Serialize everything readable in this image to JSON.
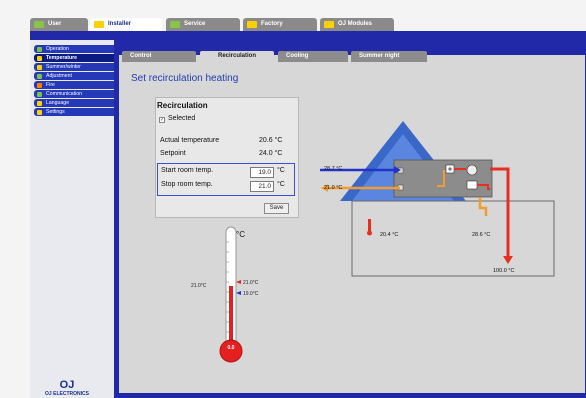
{
  "top_tabs": [
    {
      "label": "User",
      "color": "#8bc34a"
    },
    {
      "label": "Installer",
      "color": "#ffd000"
    },
    {
      "label": "Service",
      "color": "#8bc34a"
    },
    {
      "label": "Factory",
      "color": "#ffd000"
    },
    {
      "label": "OJ Modules",
      "color": "#ffd000"
    }
  ],
  "sidebar": {
    "items": [
      {
        "label": "Operation",
        "icon": "gear-icon",
        "color": "#7ac143"
      },
      {
        "label": "Temperature",
        "icon": "thermometer-icon",
        "color": "#ffd000"
      },
      {
        "label": "Summer/winter",
        "icon": "sun-icon",
        "color": "#ffd000"
      },
      {
        "label": "Adjustment",
        "icon": "wrench-icon",
        "color": "#7ac143"
      },
      {
        "label": "Fire",
        "icon": "fire-icon",
        "color": "#ff8000"
      },
      {
        "label": "Communication",
        "icon": "network-icon",
        "color": "#7ac143"
      },
      {
        "label": "Language",
        "icon": "flag-icon",
        "color": "#ffd000"
      },
      {
        "label": "Settings",
        "icon": "folder-icon",
        "color": "#ffd000"
      }
    ],
    "logo_mark": "OJ",
    "logo_text": "OJ ELECTRONICS"
  },
  "subtabs": [
    "Control",
    "Recirculation",
    "Cooling",
    "Summer night"
  ],
  "page_title": "Set recirculation heating",
  "panel": {
    "title": "Recirculation",
    "selected_label": "Selected",
    "checkmark": "✓",
    "actual_label": "Actual temperature",
    "actual_value": "20.6 °C",
    "setpoint_label": "Setpoint",
    "setpoint_value": "24.0 °C",
    "start_label": "Start room temp.",
    "start_value": "19.0",
    "stop_label": "Stop room temp.",
    "stop_value": "21.0",
    "unit": "°C",
    "save_label": "Save"
  },
  "thermometer": {
    "unit": "°C",
    "left_label": "21.0°C",
    "mark_high": "21.0°C",
    "mark_low": "19.0°C",
    "bulb_value": "0.0"
  },
  "house": {
    "supply_left": "28.7 °C",
    "return_left": "21.0 °C",
    "room": "20.4 °C",
    "duct": "28.6 °C",
    "outlet": "100.0 °C",
    "colors": {
      "roof": "#3a68c8",
      "supply": "#2233cc",
      "heat": "#e53020",
      "return": "#f39a30"
    }
  }
}
